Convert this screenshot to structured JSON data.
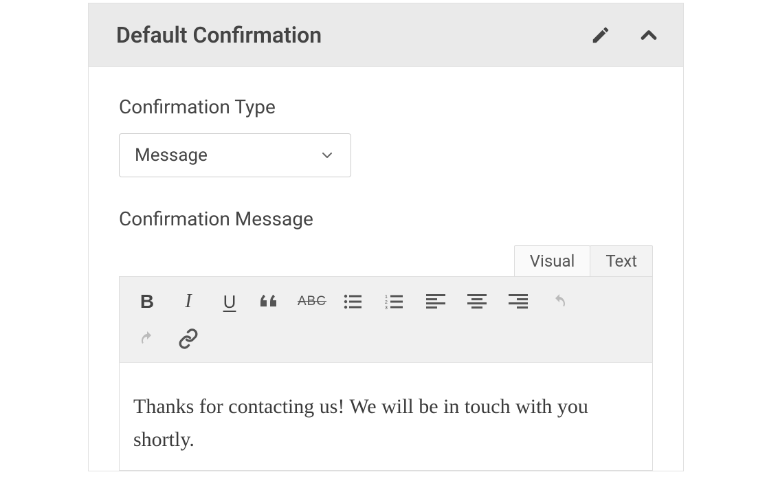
{
  "panel": {
    "title": "Default Confirmation"
  },
  "fields": {
    "type_label": "Confirmation Type",
    "type_value": "Message",
    "message_label": "Confirmation Message"
  },
  "editor": {
    "tabs": {
      "visual": "Visual",
      "text": "Text"
    },
    "toolbar": {
      "bold": "B",
      "italic": "I",
      "underline": "U",
      "strike": "ABC"
    },
    "content": "Thanks for contacting us! We will be in touch with you shortly."
  }
}
